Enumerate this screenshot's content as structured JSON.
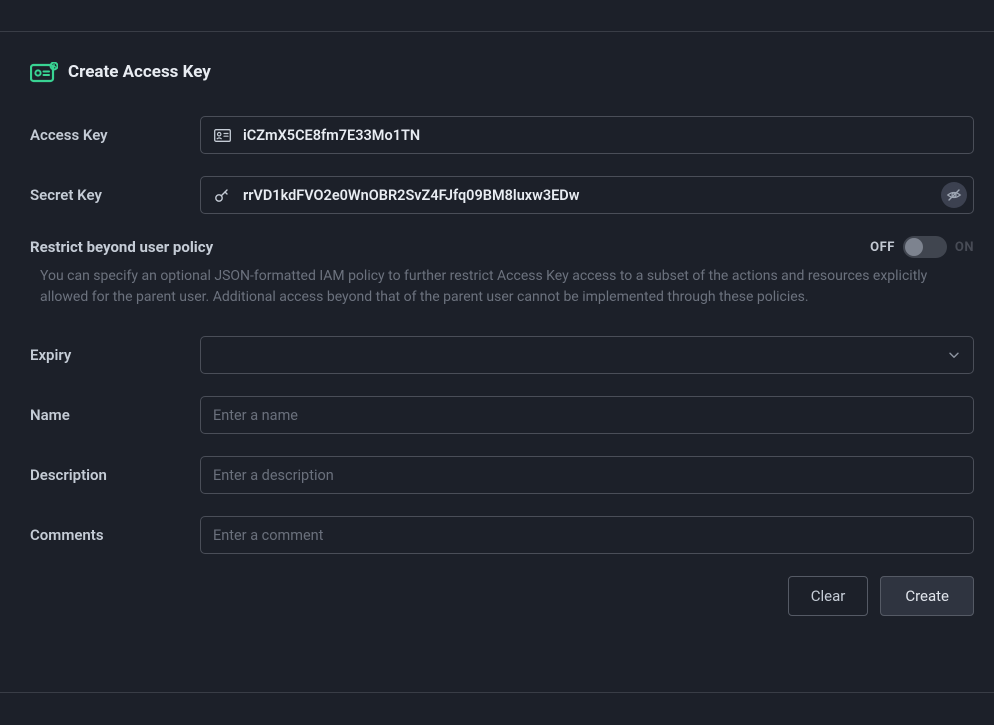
{
  "header": {
    "title": "Create Access Key"
  },
  "labels": {
    "access_key": "Access Key",
    "secret_key": "Secret Key",
    "expiry": "Expiry",
    "name": "Name",
    "description": "Description",
    "comments": "Comments"
  },
  "values": {
    "access_key": "iCZmX5CE8fm7E33Mo1TN",
    "secret_key": "rrVD1kdFVO2e0WnOBR2SvZ4FJfq09BM8luxw3EDw",
    "expiry": "",
    "name": "",
    "description": "",
    "comments": ""
  },
  "placeholders": {
    "name": "Enter a name",
    "description": "Enter a description",
    "comments": "Enter a comment"
  },
  "policy": {
    "title": "Restrict beyond user policy",
    "description": "You can specify an optional JSON-formatted IAM policy to further restrict Access Key access to a subset of the actions and resources explicitly allowed for the parent user. Additional access beyond that of the parent user cannot be implemented through these policies.",
    "toggle_off": "OFF",
    "toggle_on": "ON",
    "toggle_state": "off"
  },
  "buttons": {
    "clear": "Clear",
    "create": "Create"
  },
  "colors": {
    "accent": "#39d393",
    "bg": "#1c2029",
    "border": "#4a4e58"
  }
}
